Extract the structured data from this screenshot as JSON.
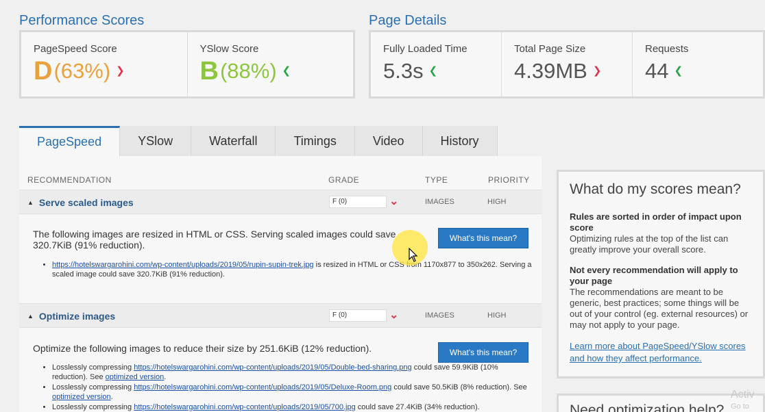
{
  "performance": {
    "title": "Performance Scores",
    "pagespeed": {
      "label": "PageSpeed Score",
      "grade": "D",
      "pct": "(63%)",
      "trend": "down"
    },
    "yslow": {
      "label": "YSlow Score",
      "grade": "B",
      "pct": "(88%)",
      "trend": "up"
    }
  },
  "details": {
    "title": "Page Details",
    "load": {
      "label": "Fully Loaded Time",
      "value": "5.3s",
      "trend": "up"
    },
    "size": {
      "label": "Total Page Size",
      "value": "4.39MB",
      "trend": "down"
    },
    "requests": {
      "label": "Requests",
      "value": "44",
      "trend": "up"
    }
  },
  "tabs": [
    "PageSpeed",
    "YSlow",
    "Waterfall",
    "Timings",
    "Video",
    "History"
  ],
  "table": {
    "headers": {
      "rec": "RECOMMENDATION",
      "grade": "GRADE",
      "type": "TYPE",
      "priority": "PRIORITY"
    },
    "rows": [
      {
        "title": "Serve scaled images",
        "grade": "F (0)",
        "type": "IMAGES",
        "priority": "HIGH",
        "desc": "The following images are resized in HTML or CSS. Serving scaled images could save 320.7KiB (91% reduction).",
        "button": "What's this mean?",
        "items": [
          {
            "link": "https://hotelswargarohini.com/wp-content/uploads/2019/05/rupin-supin-trek.jpg",
            "text": " is resized in HTML or CSS from 1170x877 to 350x262. Serving a scaled image could save 320.7KiB (91% reduction)."
          }
        ]
      },
      {
        "title": "Optimize images",
        "grade": "F (0)",
        "type": "IMAGES",
        "priority": "HIGH",
        "desc": "Optimize the following images to reduce their size by 251.6KiB (12% reduction).",
        "button": "What's this mean?",
        "items": [
          {
            "prefix": "Losslessly compressing ",
            "link": "https://hotelswargarohini.com/wp-content/uploads/2019/05/Double-bed-sharing.png",
            "text": " could save 59.9KiB (10% reduction). See ",
            "link2": "optimized version",
            "suffix": "."
          },
          {
            "prefix": "Losslessly compressing ",
            "link": "https://hotelswargarohini.com/wp-content/uploads/2019/05/Deluxe-Room.png",
            "text": " could save 50.5KiB (8% reduction). See ",
            "link2": "optimized version",
            "suffix": "."
          },
          {
            "prefix": "Losslessly compressing ",
            "link": "https://hotelswargarohini.com/wp-content/uploads/2019/05/700.jpg",
            "text": " could save 27.4KiB (34% reduction).",
            "link2": "",
            "suffix": ""
          }
        ]
      }
    ]
  },
  "sidebar": {
    "title": "What do my scores mean?",
    "b1": "Rules are sorted in order of impact upon score",
    "p1": "Optimizing rules at the top of the list can greatly improve your overall score.",
    "b2": "Not every recommendation will apply to your page",
    "p2": "The recommendations are meant to be generic, best practices; some things will be out of your control (eg. external resources) or may not apply to your page.",
    "link": "Learn more about PageSpeed/YSlow scores and how they affect performance.",
    "next_title": "Need optimization help?"
  },
  "watermark": {
    "line1": "Activ",
    "line2": "Go to"
  },
  "colors": {
    "accent": "#2a6fb0",
    "grade_d": "#e8a13c",
    "grade_b": "#8ec53f",
    "up": "#2aa34a",
    "down": "#e0334e",
    "button": "#2a79c4"
  }
}
